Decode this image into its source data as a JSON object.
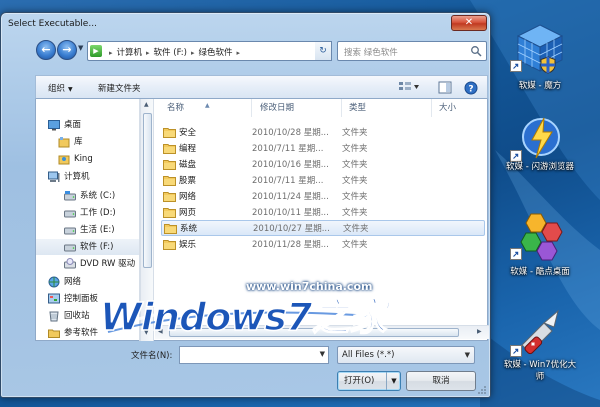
{
  "window": {
    "title": "Select Executable...",
    "close_glyph": "✕"
  },
  "address_bar": {
    "crumbs": [
      "计算机",
      "软件 (F:)",
      "绿色软件"
    ],
    "separator": "▸"
  },
  "search": {
    "placeholder": "搜索 绿色软件"
  },
  "toolbar": {
    "organize": "组织",
    "new_folder": "新建文件夹"
  },
  "navigation": {
    "items": [
      {
        "label": "桌面",
        "icon": "desktop-icon"
      },
      {
        "label": "库",
        "icon": "library-icon"
      },
      {
        "label": "King",
        "icon": "user-folder-icon"
      },
      {
        "label": "计算机",
        "icon": "computer-icon"
      },
      {
        "label": "系统 (C:)",
        "icon": "drive-icon"
      },
      {
        "label": "工作 (D:)",
        "icon": "drive-icon"
      },
      {
        "label": "生活 (E:)",
        "icon": "drive-icon"
      },
      {
        "label": "软件 (F:)",
        "icon": "drive-icon"
      },
      {
        "label": "DVD RW 驱动",
        "icon": "dvd-drive-icon"
      },
      {
        "label": "网络",
        "icon": "network-icon"
      },
      {
        "label": "控制面板",
        "icon": "control-panel-icon"
      },
      {
        "label": "回收站",
        "icon": "recycle-bin-icon"
      },
      {
        "label": "参考软件",
        "icon": "folder-icon"
      }
    ]
  },
  "file_list": {
    "columns": [
      "名称",
      "修改日期",
      "类型",
      "大小"
    ],
    "rows": [
      {
        "name": "安全",
        "date": "2010/10/28 星期...",
        "type": "文件夹"
      },
      {
        "name": "编程",
        "date": "2010/7/11 星期...",
        "type": "文件夹"
      },
      {
        "name": "磁盘",
        "date": "2010/10/16 星期...",
        "type": "文件夹"
      },
      {
        "name": "股票",
        "date": "2010/7/11 星期...",
        "type": "文件夹"
      },
      {
        "name": "网络",
        "date": "2010/11/24 星期...",
        "type": "文件夹"
      },
      {
        "name": "网页",
        "date": "2010/10/11 星期...",
        "type": "文件夹"
      },
      {
        "name": "系统",
        "date": "2010/10/27 星期...",
        "type": "文件夹"
      },
      {
        "name": "娱乐",
        "date": "2010/11/28 星期...",
        "type": "文件夹"
      }
    ],
    "selected_index": 6
  },
  "footer": {
    "filename_label": "文件名(N):",
    "filename_value": "",
    "filter": "All Files (*.*)",
    "open_button": "打开(O)",
    "cancel_button": "取消"
  },
  "desktop_icons": [
    {
      "label": "软媒 - 魔方"
    },
    {
      "label": "软媒 - 闪游浏览器"
    },
    {
      "label": "软媒 - 酷点桌面"
    },
    {
      "label": "软媒 - Win7优化大师"
    }
  ],
  "watermark": {
    "brand": "Windows7之家",
    "url": "www.win7china.com"
  },
  "colors": {
    "desktop": "#155a9c",
    "close_button": "#c03921",
    "selection": "#dae8f8",
    "watermark": "#1c56b8"
  }
}
